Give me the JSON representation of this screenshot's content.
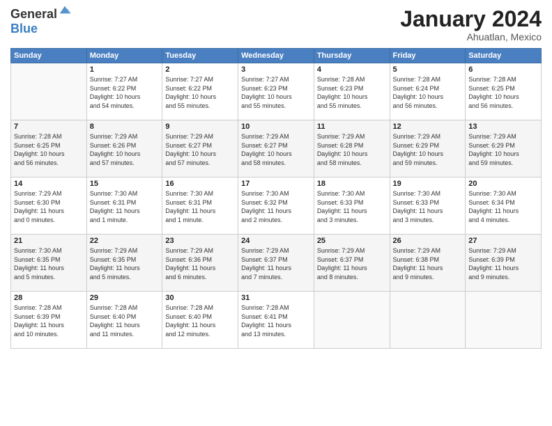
{
  "header": {
    "logo_general": "General",
    "logo_blue": "Blue",
    "month_title": "January 2024",
    "subtitle": "Ahuatlan, Mexico"
  },
  "days_of_week": [
    "Sunday",
    "Monday",
    "Tuesday",
    "Wednesday",
    "Thursday",
    "Friday",
    "Saturday"
  ],
  "weeks": [
    [
      {
        "day": "",
        "info": ""
      },
      {
        "day": "1",
        "info": "Sunrise: 7:27 AM\nSunset: 6:22 PM\nDaylight: 10 hours\nand 54 minutes."
      },
      {
        "day": "2",
        "info": "Sunrise: 7:27 AM\nSunset: 6:22 PM\nDaylight: 10 hours\nand 55 minutes."
      },
      {
        "day": "3",
        "info": "Sunrise: 7:27 AM\nSunset: 6:23 PM\nDaylight: 10 hours\nand 55 minutes."
      },
      {
        "day": "4",
        "info": "Sunrise: 7:28 AM\nSunset: 6:23 PM\nDaylight: 10 hours\nand 55 minutes."
      },
      {
        "day": "5",
        "info": "Sunrise: 7:28 AM\nSunset: 6:24 PM\nDaylight: 10 hours\nand 56 minutes."
      },
      {
        "day": "6",
        "info": "Sunrise: 7:28 AM\nSunset: 6:25 PM\nDaylight: 10 hours\nand 56 minutes."
      }
    ],
    [
      {
        "day": "7",
        "info": "Sunrise: 7:28 AM\nSunset: 6:25 PM\nDaylight: 10 hours\nand 56 minutes."
      },
      {
        "day": "8",
        "info": "Sunrise: 7:29 AM\nSunset: 6:26 PM\nDaylight: 10 hours\nand 57 minutes."
      },
      {
        "day": "9",
        "info": "Sunrise: 7:29 AM\nSunset: 6:27 PM\nDaylight: 10 hours\nand 57 minutes."
      },
      {
        "day": "10",
        "info": "Sunrise: 7:29 AM\nSunset: 6:27 PM\nDaylight: 10 hours\nand 58 minutes."
      },
      {
        "day": "11",
        "info": "Sunrise: 7:29 AM\nSunset: 6:28 PM\nDaylight: 10 hours\nand 58 minutes."
      },
      {
        "day": "12",
        "info": "Sunrise: 7:29 AM\nSunset: 6:29 PM\nDaylight: 10 hours\nand 59 minutes."
      },
      {
        "day": "13",
        "info": "Sunrise: 7:29 AM\nSunset: 6:29 PM\nDaylight: 10 hours\nand 59 minutes."
      }
    ],
    [
      {
        "day": "14",
        "info": "Sunrise: 7:29 AM\nSunset: 6:30 PM\nDaylight: 11 hours\nand 0 minutes."
      },
      {
        "day": "15",
        "info": "Sunrise: 7:30 AM\nSunset: 6:31 PM\nDaylight: 11 hours\nand 1 minute."
      },
      {
        "day": "16",
        "info": "Sunrise: 7:30 AM\nSunset: 6:31 PM\nDaylight: 11 hours\nand 1 minute."
      },
      {
        "day": "17",
        "info": "Sunrise: 7:30 AM\nSunset: 6:32 PM\nDaylight: 11 hours\nand 2 minutes."
      },
      {
        "day": "18",
        "info": "Sunrise: 7:30 AM\nSunset: 6:33 PM\nDaylight: 11 hours\nand 3 minutes."
      },
      {
        "day": "19",
        "info": "Sunrise: 7:30 AM\nSunset: 6:33 PM\nDaylight: 11 hours\nand 3 minutes."
      },
      {
        "day": "20",
        "info": "Sunrise: 7:30 AM\nSunset: 6:34 PM\nDaylight: 11 hours\nand 4 minutes."
      }
    ],
    [
      {
        "day": "21",
        "info": "Sunrise: 7:30 AM\nSunset: 6:35 PM\nDaylight: 11 hours\nand 5 minutes."
      },
      {
        "day": "22",
        "info": "Sunrise: 7:29 AM\nSunset: 6:35 PM\nDaylight: 11 hours\nand 5 minutes."
      },
      {
        "day": "23",
        "info": "Sunrise: 7:29 AM\nSunset: 6:36 PM\nDaylight: 11 hours\nand 6 minutes."
      },
      {
        "day": "24",
        "info": "Sunrise: 7:29 AM\nSunset: 6:37 PM\nDaylight: 11 hours\nand 7 minutes."
      },
      {
        "day": "25",
        "info": "Sunrise: 7:29 AM\nSunset: 6:37 PM\nDaylight: 11 hours\nand 8 minutes."
      },
      {
        "day": "26",
        "info": "Sunrise: 7:29 AM\nSunset: 6:38 PM\nDaylight: 11 hours\nand 9 minutes."
      },
      {
        "day": "27",
        "info": "Sunrise: 7:29 AM\nSunset: 6:39 PM\nDaylight: 11 hours\nand 9 minutes."
      }
    ],
    [
      {
        "day": "28",
        "info": "Sunrise: 7:28 AM\nSunset: 6:39 PM\nDaylight: 11 hours\nand 10 minutes."
      },
      {
        "day": "29",
        "info": "Sunrise: 7:28 AM\nSunset: 6:40 PM\nDaylight: 11 hours\nand 11 minutes."
      },
      {
        "day": "30",
        "info": "Sunrise: 7:28 AM\nSunset: 6:40 PM\nDaylight: 11 hours\nand 12 minutes."
      },
      {
        "day": "31",
        "info": "Sunrise: 7:28 AM\nSunset: 6:41 PM\nDaylight: 11 hours\nand 13 minutes."
      },
      {
        "day": "",
        "info": ""
      },
      {
        "day": "",
        "info": ""
      },
      {
        "day": "",
        "info": ""
      }
    ]
  ]
}
